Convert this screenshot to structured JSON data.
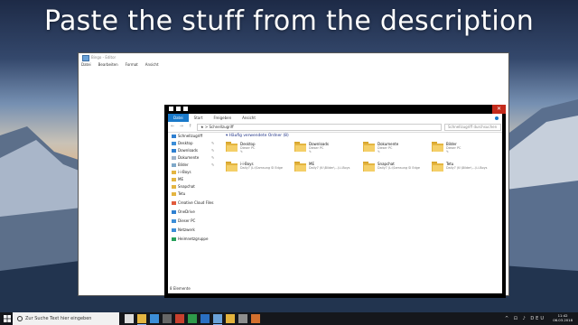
{
  "headline": "Paste the stuff from the description",
  "notepad": {
    "title": "Bingo - Editor",
    "menu": [
      "Datei",
      "Bearbeiten",
      "Format",
      "Ansicht"
    ]
  },
  "explorer": {
    "close_glyph": "✕",
    "ribbon_tabs": [
      "Datei",
      "Start",
      "Freigeben",
      "Ansicht"
    ],
    "address_nav": "← → ↑",
    "address_path": "★ > Schnellzugriff",
    "search_placeholder": "Schnellzugriff durchsuchen",
    "nav_items": [
      {
        "label": "Schnellzugriff",
        "icon": "star-icon",
        "color": "#2f80d1",
        "pinned": false
      },
      {
        "label": "Desktop",
        "icon": "desktop-icon",
        "color": "#3c8ed8",
        "pinned": true
      },
      {
        "label": "Downloads",
        "icon": "download-icon",
        "color": "#2f80d1",
        "pinned": true
      },
      {
        "label": "Dokumente",
        "icon": "document-icon",
        "color": "#9fb2c8",
        "pinned": true
      },
      {
        "label": "Bilder",
        "icon": "pictures-icon",
        "color": "#7fa8c9",
        "pinned": true
      },
      {
        "label": "i-i-Boys",
        "icon": "folder-icon",
        "color": "#e4b541",
        "pinned": false
      },
      {
        "label": "ME",
        "icon": "folder-icon",
        "color": "#e4b541",
        "pinned": false
      },
      {
        "label": "Snapchat",
        "icon": "folder-icon",
        "color": "#e4b541",
        "pinned": false
      },
      {
        "label": "Tetu",
        "icon": "folder-icon",
        "color": "#e4b541",
        "pinned": false
      },
      {
        "label": "Creative Cloud Files",
        "icon": "cloud-icon",
        "color": "#e15a3c",
        "pinned": false
      },
      {
        "label": "OneDrive",
        "icon": "onedrive-icon",
        "color": "#2f80d1",
        "pinned": false
      },
      {
        "label": "Dieser PC",
        "icon": "computer-icon",
        "color": "#3c8ed8",
        "pinned": false
      },
      {
        "label": "Netzwerk",
        "icon": "network-icon",
        "color": "#3c8ed8",
        "pinned": false
      },
      {
        "label": "Heimnetzgruppe",
        "icon": "homegroup-icon",
        "color": "#27a05a",
        "pinned": false
      }
    ],
    "group_header": "Häufig verwendete Ordner (8)",
    "folders": [
      {
        "name": "Desktop",
        "location": "Dieser PC"
      },
      {
        "name": "Downloads",
        "location": "Dieser PC"
      },
      {
        "name": "Dokumente",
        "location": "Dieser PC"
      },
      {
        "name": "Bilder",
        "location": "Dieser PC"
      },
      {
        "name": "i-i-Boys",
        "location": "Daily7 (L:\\Samsung SI Edge"
      },
      {
        "name": "ME",
        "location": "Daily7 (K:\\Bilder\\...\\i-i-Boys"
      },
      {
        "name": "Snapchat",
        "location": "Daily7 (L:\\Samsung SI Edge"
      },
      {
        "name": "Tetu",
        "location": "Daily7 (K:\\Bilder\\...\\i-i-Boys"
      }
    ],
    "status": "8 Elemente"
  },
  "taskbar": {
    "search_text": "Zur Suche Text hier eingeben",
    "tray": "^ ⊡ ♪ DEU",
    "time": "11:42",
    "date": "06.03.2018"
  }
}
